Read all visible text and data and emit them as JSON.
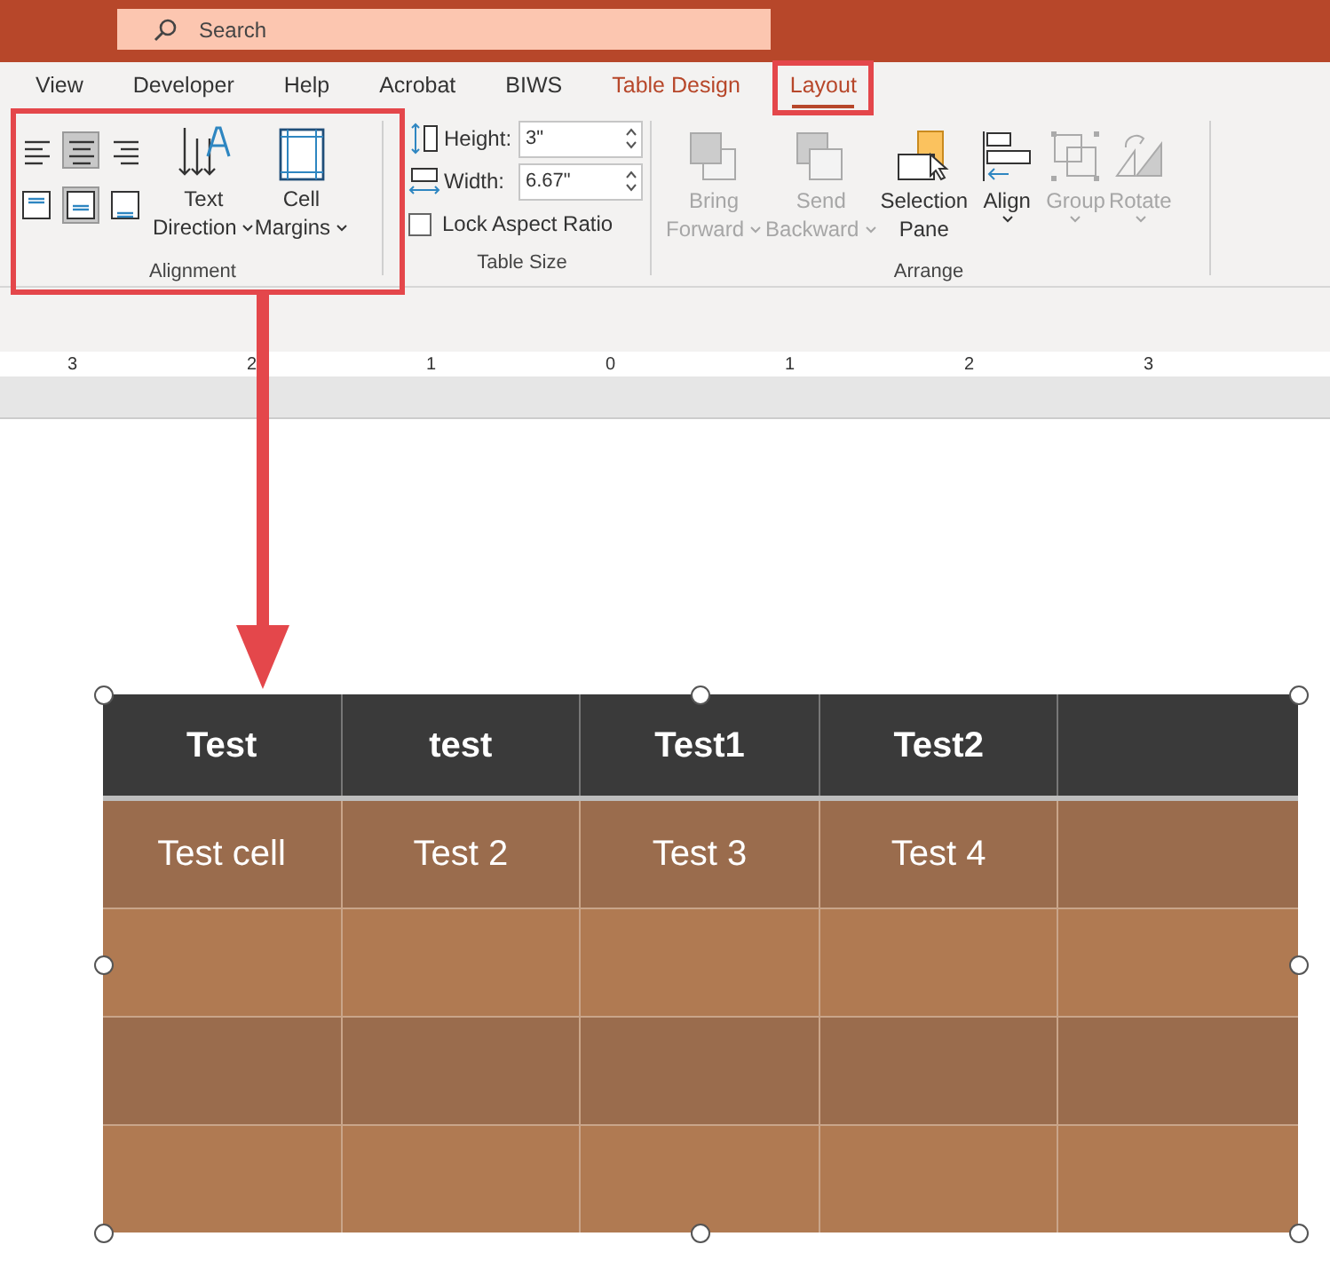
{
  "search": {
    "placeholder": "Search"
  },
  "tabs": [
    {
      "label": "View",
      "selected": false,
      "contextual": false
    },
    {
      "label": "Developer",
      "selected": false,
      "contextual": false
    },
    {
      "label": "Help",
      "selected": false,
      "contextual": false
    },
    {
      "label": "Acrobat",
      "selected": false,
      "contextual": false
    },
    {
      "label": "BIWS",
      "selected": false,
      "contextual": false
    },
    {
      "label": "Table Design",
      "selected": false,
      "contextual": true
    },
    {
      "label": "Layout",
      "selected": true,
      "contextual": true
    }
  ],
  "alignment": {
    "horizontal": [
      {
        "selected": false
      },
      {
        "selected": true
      },
      {
        "selected": false
      }
    ],
    "vertical": [
      {
        "selected": false
      },
      {
        "selected": true
      },
      {
        "selected": false
      }
    ],
    "buttons": [
      {
        "label": "Text",
        "label2": "Direction",
        "kind": "direction"
      },
      {
        "label": "Cell",
        "label2": "Margins",
        "kind": "margins"
      }
    ],
    "group_label": "Alignment"
  },
  "table_size": {
    "height": {
      "label": "Height:",
      "value": "3\""
    },
    "width": {
      "label": "Width:",
      "value": "6.67\""
    },
    "lock": {
      "label": "Lock Aspect Ratio",
      "checked": false
    },
    "group_label": "Table Size"
  },
  "arrange": {
    "buttons": [
      {
        "label": "Bring",
        "label2": "Forward",
        "kind": "forward",
        "disabled": true
      },
      {
        "label": "Send",
        "label2": "Backward",
        "kind": "backward",
        "disabled": true
      },
      {
        "label": "Selection",
        "label2": "Pane",
        "kind": "pane",
        "disabled": false
      },
      {
        "label": "Align",
        "kind": "align",
        "disabled": false
      },
      {
        "label": "Group",
        "kind": "group",
        "disabled": true
      },
      {
        "label": "Rotate",
        "kind": "rotate",
        "disabled": true
      }
    ],
    "group_label": "Arrange"
  },
  "ruler": [
    "3",
    "2",
    "1",
    "0",
    "1",
    "2",
    "3"
  ],
  "table": {
    "columns": [
      "Test",
      "test",
      "Test1",
      "Test2"
    ],
    "rows": [
      {
        "color": "#9a6c4d",
        "cells": [
          "Test cell",
          "Test 2",
          "Test 3",
          "Test 4"
        ]
      },
      {
        "color": "#b07a52"
      },
      {
        "color": "#9a6c4d"
      },
      {
        "color": "#b07a52"
      }
    ]
  }
}
